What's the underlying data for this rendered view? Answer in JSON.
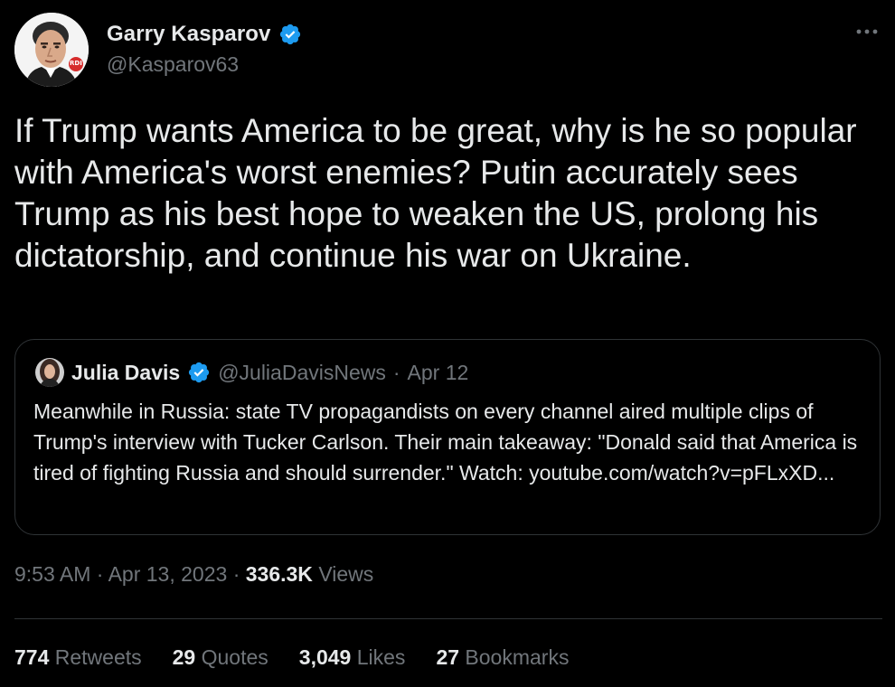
{
  "author": {
    "display_name": "Garry Kasparov",
    "handle": "@Kasparov63",
    "verified": true,
    "avatar_badge": "RDI"
  },
  "tweet": {
    "text": "If Trump wants America to be great, why is he so popular with America's worst enemies? Putin accurately sees Trump as his best hope to weaken the US, prolong his dictatorship, and continue his war on Ukraine."
  },
  "quoted_tweet": {
    "display_name": "Julia Davis",
    "handle": "@JuliaDavisNews",
    "separator": "·",
    "date": "Apr 12",
    "verified": true,
    "text": "Meanwhile in Russia: state TV propagandists on every channel aired multiple clips of Trump's interview with Tucker Carlson. Their main takeaway: \"Donald said that America is tired of fighting Russia and should surrender.\" Watch: ",
    "link": "youtube.com/watch?v=pFLxXD..."
  },
  "meta": {
    "time": "9:53 AM",
    "separator": "·",
    "date": "Apr 13, 2023",
    "views_count": "336.3K",
    "views_label": "Views"
  },
  "stats": {
    "retweets_count": "774",
    "retweets_label": "Retweets",
    "quotes_count": "29",
    "quotes_label": "Quotes",
    "likes_count": "3,049",
    "likes_label": "Likes",
    "bookmarks_count": "27",
    "bookmarks_label": "Bookmarks"
  },
  "colors": {
    "background": "#000000",
    "text_primary": "#e7e9ea",
    "text_secondary": "#71767b",
    "verified_badge": "#1d9bf0",
    "border": "#2f3336"
  },
  "icons": {
    "verified": "verified-badge-icon",
    "more": "more-options-icon"
  }
}
